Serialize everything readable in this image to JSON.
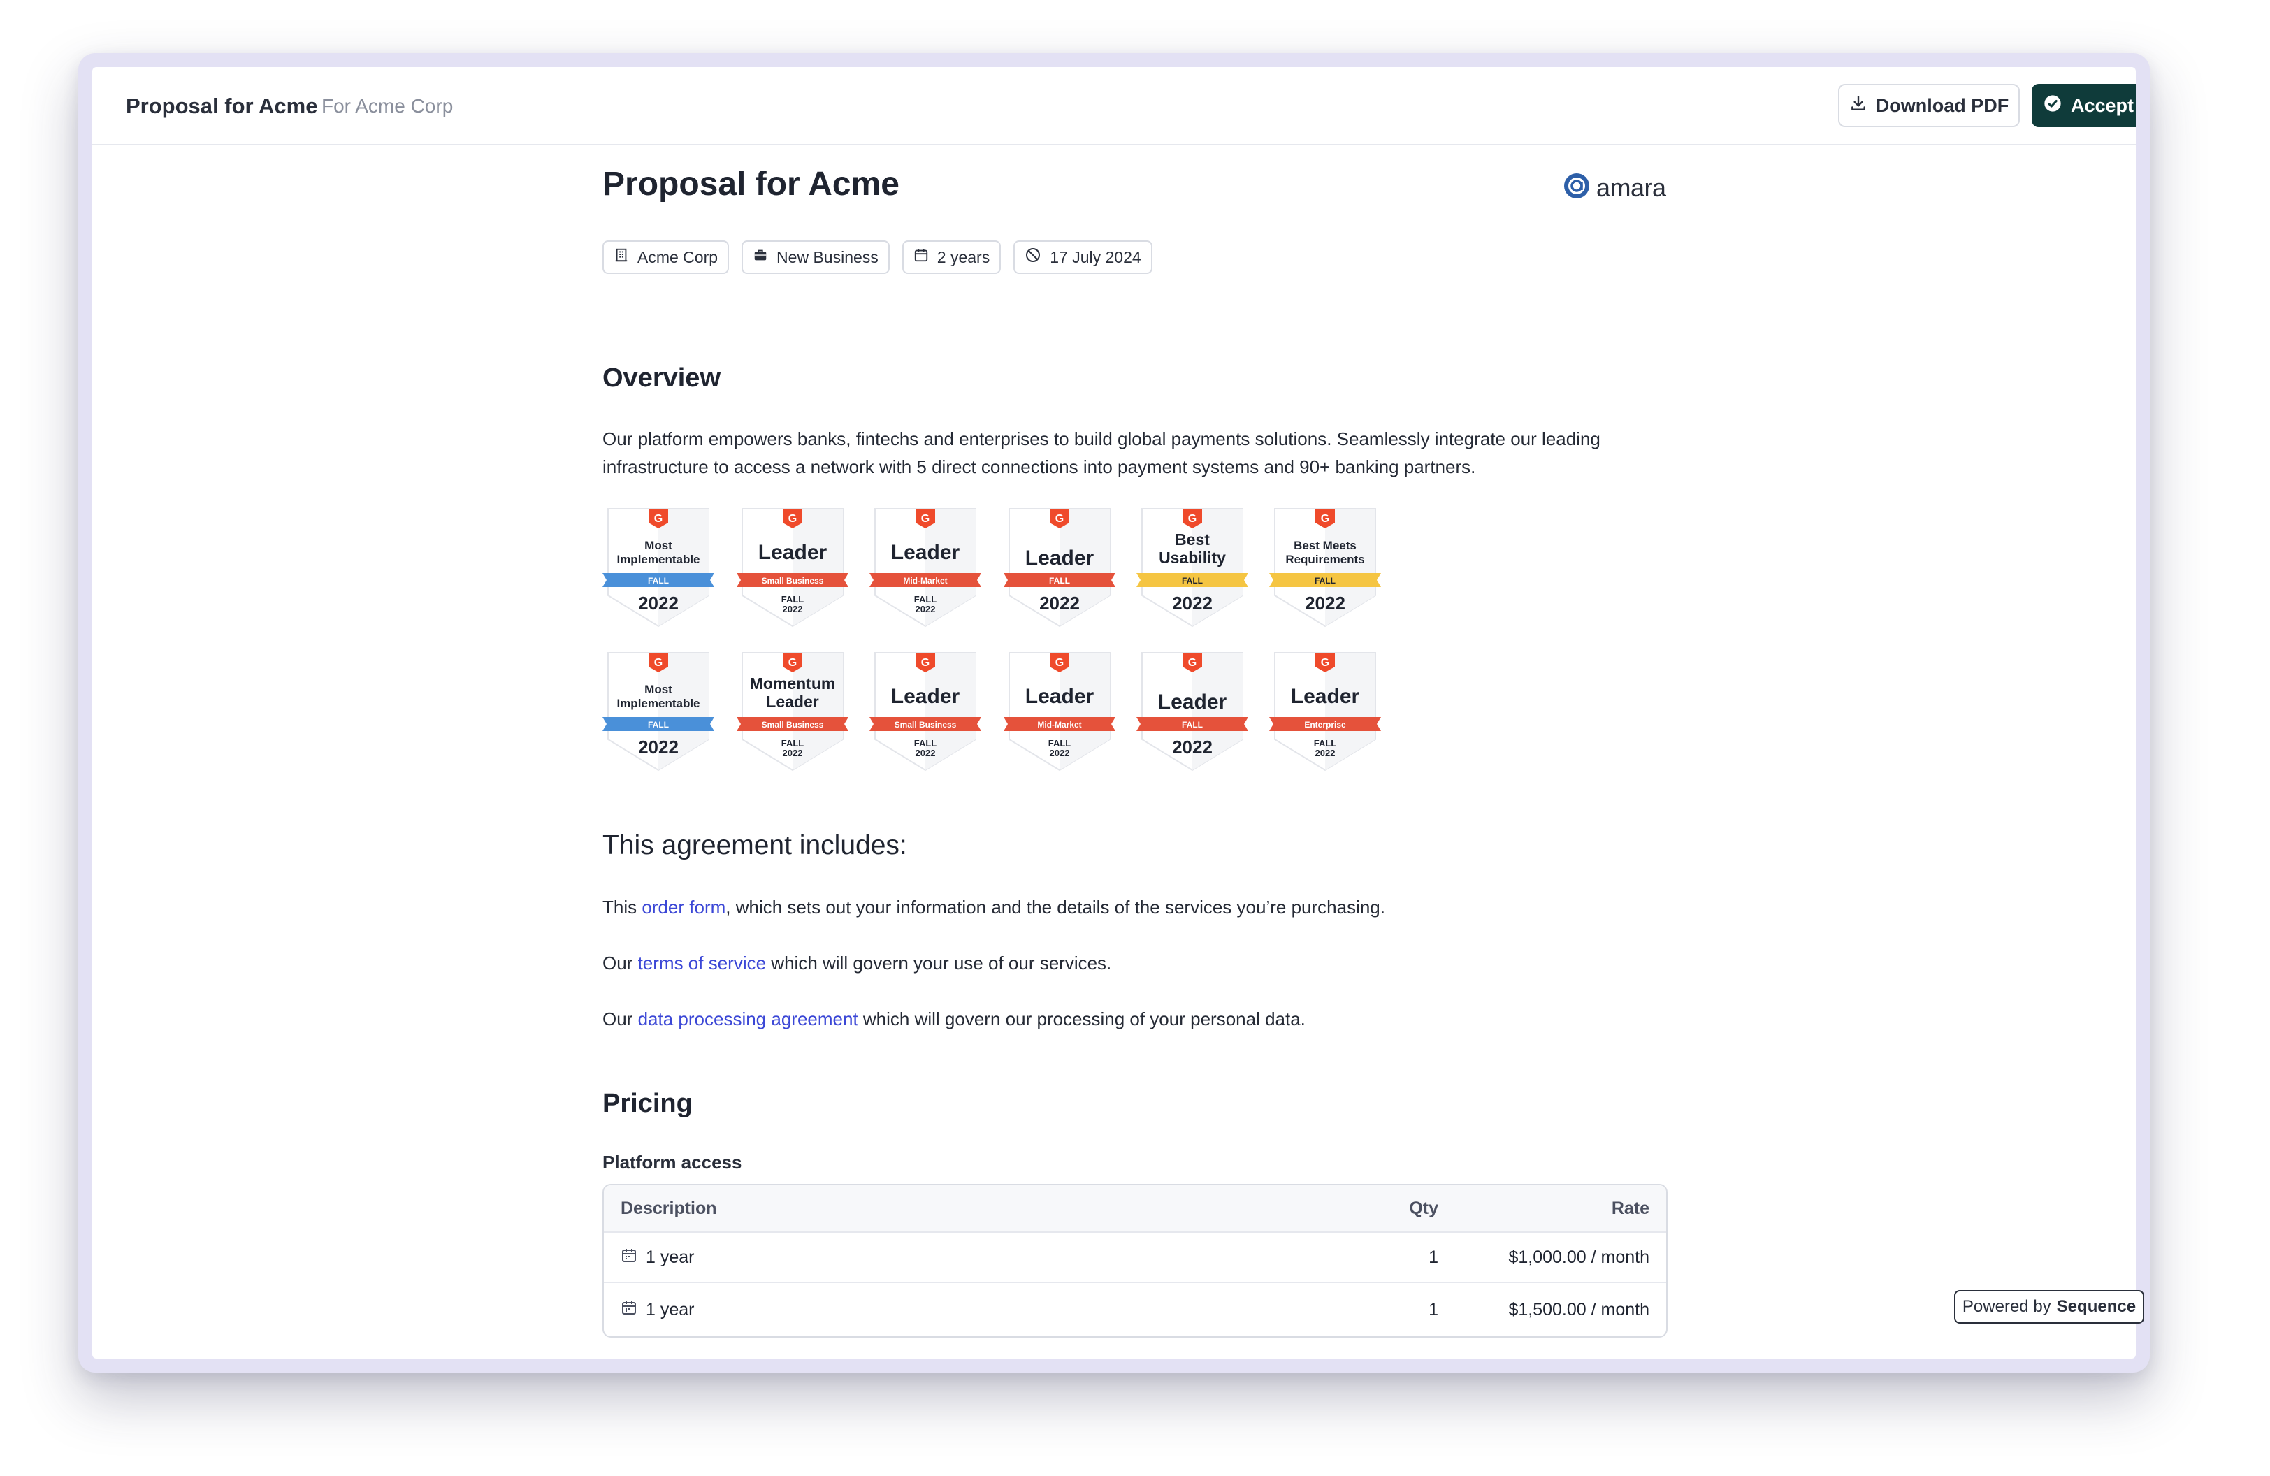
{
  "header": {
    "title": "Proposal for Acme",
    "subtitle": "For Acme Corp",
    "download_label": "Download PDF",
    "accept_label": "Accept"
  },
  "doc": {
    "title": "Proposal for Acme",
    "logo_text": "amara",
    "tags": [
      {
        "icon": "building-icon",
        "label": "Acme Corp"
      },
      {
        "icon": "briefcase-icon",
        "label": "New Business"
      },
      {
        "icon": "calendar-icon",
        "label": "2 years"
      },
      {
        "icon": "prohibited-icon",
        "label": "17 July 2024"
      }
    ]
  },
  "overview": {
    "heading": "Overview",
    "text": "Our platform empowers banks, fintechs and enterprises to build global payments solutions. Seamlessly integrate our leading infrastructure to access a network with 5 direct connections into payment systems and 90+ banking partners."
  },
  "badges": [
    {
      "title": "Most Implementable",
      "ribbon": "FALL",
      "season": "",
      "year": "2022",
      "ribbon_color": "#4a90d9"
    },
    {
      "title": "Leader",
      "ribbon": "Small Business",
      "season": "FALL",
      "year": "2022",
      "ribbon_color": "#e5523b"
    },
    {
      "title": "Leader",
      "ribbon": "Mid-Market",
      "season": "FALL",
      "year": "2022",
      "ribbon_color": "#e5523b"
    },
    {
      "title": "Leader",
      "ribbon": "FALL",
      "season": "",
      "year": "2022",
      "ribbon_color": "#e5523b"
    },
    {
      "title": "Best Usability",
      "ribbon": "FALL",
      "season": "",
      "year": "2022",
      "ribbon_color": "#f5c542"
    },
    {
      "title": "Best Meets Requirements",
      "ribbon": "FALL",
      "season": "",
      "year": "2022",
      "ribbon_color": "#f5c542"
    },
    {
      "title": "Most Implementable",
      "ribbon": "FALL",
      "season": "",
      "year": "2022",
      "ribbon_color": "#4a90d9"
    },
    {
      "title": "Momentum Leader",
      "ribbon": "Small Business",
      "season": "FALL",
      "year": "2022",
      "ribbon_color": "#e5523b"
    },
    {
      "title": "Leader",
      "ribbon": "Small Business",
      "season": "FALL",
      "year": "2022",
      "ribbon_color": "#e5523b"
    },
    {
      "title": "Leader",
      "ribbon": "Mid-Market",
      "season": "FALL",
      "year": "2022",
      "ribbon_color": "#e5523b"
    },
    {
      "title": "Leader",
      "ribbon": "FALL",
      "season": "",
      "year": "2022",
      "ribbon_color": "#e5523b"
    },
    {
      "title": "Leader",
      "ribbon": "Enterprise",
      "season": "FALL",
      "year": "2022",
      "ribbon_color": "#e5523b"
    }
  ],
  "agreement": {
    "heading": "This agreement includes:",
    "items": [
      {
        "prefix": "This ",
        "link": "order form",
        "suffix": ", which sets out your information and the details of the services you’re purchasing."
      },
      {
        "prefix": "Our ",
        "link": "terms of service",
        "suffix": " which will govern your use of our services."
      },
      {
        "prefix": "Our ",
        "link": "data processing agreement",
        "suffix": " which will govern our processing of your personal data."
      }
    ]
  },
  "pricing": {
    "heading": "Pricing",
    "section_label": "Platform access",
    "columns": {
      "description": "Description",
      "qty": "Qty",
      "rate": "Rate"
    },
    "rows": [
      {
        "description": "1 year",
        "qty": "1",
        "rate": "$1,000.00 / month"
      },
      {
        "description": "1 year",
        "qty": "1",
        "rate": "$1,500.00 / month"
      }
    ]
  },
  "footer": {
    "powered_prefix": "Powered by",
    "powered_brand": "Sequence"
  },
  "colors": {
    "accent": "#0f3b3a",
    "link": "#3b47d6",
    "frame": "#e3e1f4"
  }
}
